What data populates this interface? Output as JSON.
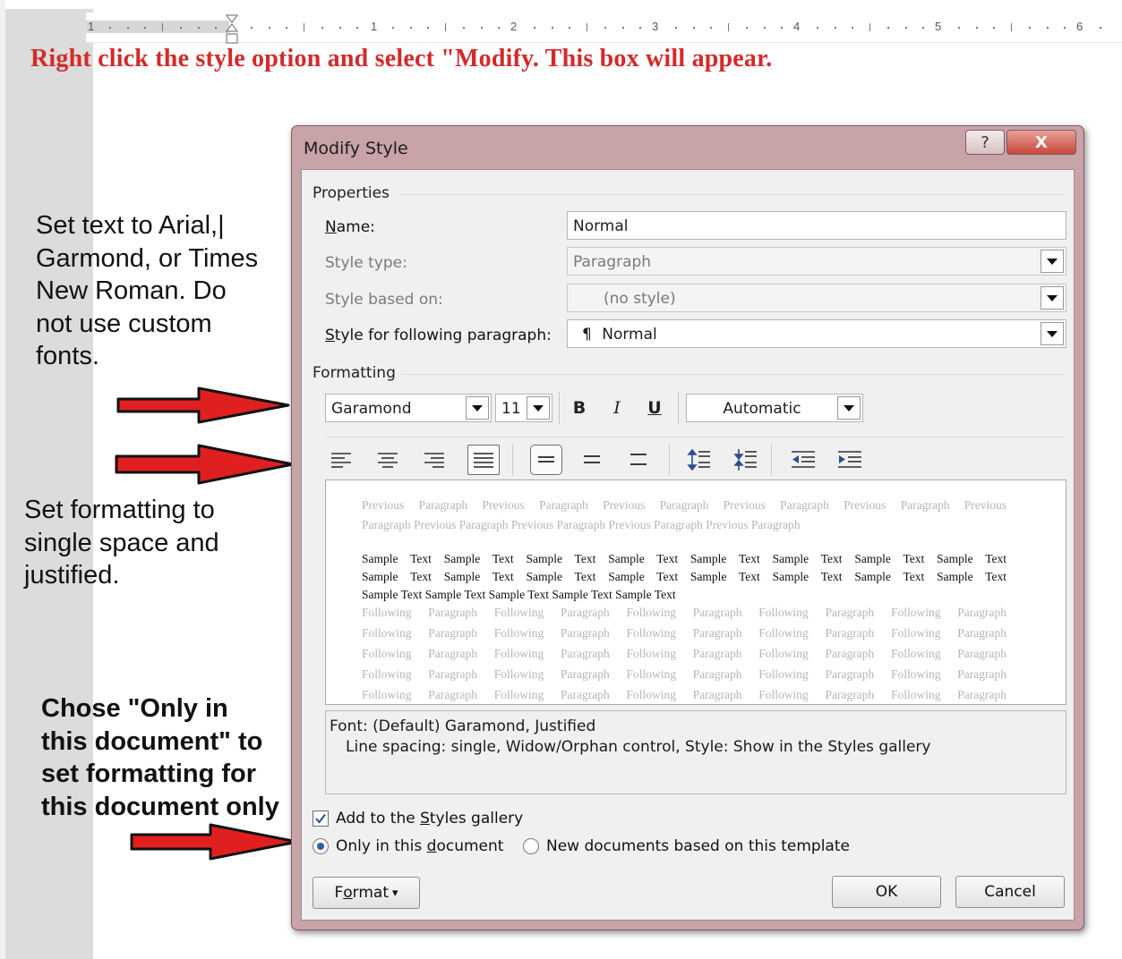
{
  "instruction_title": "Right click the style option and select \"Modify. This box will appear.",
  "notes": {
    "fonts_lines": [
      "Set text to Arial,|",
      "Garmond, or Times",
      "New Roman. Do",
      "not use custom",
      "fonts."
    ],
    "formatting_lines": [
      "Set formatting to",
      "single space and",
      "justified."
    ],
    "document_lines": [
      "Chose \"Only in",
      "this document\" to",
      "set formatting for",
      "this document only"
    ]
  },
  "ruler": {
    "numbers": [
      "1",
      "1",
      "2",
      "3",
      "4",
      "5",
      "6"
    ]
  },
  "dialog": {
    "title": "Modify Style",
    "help_glyph": "?",
    "close_glyph": "X",
    "properties": {
      "heading": "Properties",
      "name_label_key": "N",
      "name_label_rest": "ame:",
      "name_value": "Normal",
      "style_type_label": "Style type:",
      "style_type_value": "Paragraph",
      "based_on_label": "Style based on:",
      "based_on_value": "(no style)",
      "following_label_key": "S",
      "following_label_rest": "tyle for following paragraph:",
      "following_icon": "¶",
      "following_value": "Normal"
    },
    "formatting": {
      "heading": "Formatting",
      "font": "Garamond",
      "size": "11",
      "bold": "B",
      "italic": "I",
      "underline": "U",
      "color": "Automatic"
    },
    "preview": {
      "previous_lines": [
        "Previous Paragraph Previous Paragraph Previous Paragraph Previous Paragraph Previous Paragraph Previous",
        "Paragraph Previous Paragraph Previous Paragraph Previous Paragraph Previous Paragraph"
      ],
      "sample_lines": [
        "Sample Text Sample Text Sample Text Sample Text Sample Text Sample Text Sample Text Sample Text",
        "Sample Text Sample Text Sample Text Sample Text Sample Text Sample Text Sample Text Sample Text",
        "Sample Text Sample Text Sample Text Sample Text Sample Text"
      ],
      "following_lines": [
        "Following Paragraph Following Paragraph Following Paragraph Following Paragraph Following Paragraph",
        "Following Paragraph Following Paragraph Following Paragraph Following Paragraph Following Paragraph",
        "Following Paragraph Following Paragraph Following Paragraph Following Paragraph Following Paragraph",
        "Following Paragraph Following Paragraph Following Paragraph Following Paragraph Following Paragraph",
        "Following Paragraph Following Paragraph Following Paragraph Following Paragraph Following Paragraph"
      ]
    },
    "description": {
      "line1": "Font: (Default) Garamond, Justified",
      "line2": "Line spacing:  single, Widow/Orphan control, Style: Show in the Styles gallery"
    },
    "add_to_gallery": {
      "checked": true,
      "label_pre": "Add to the ",
      "label_key": "S",
      "label_post": "tyles gallery"
    },
    "scope": {
      "selected": "only_this_document",
      "only_label_pre": "Only in this ",
      "only_label_key": "d",
      "only_label_post": "ocument",
      "new_docs_label": "New documents based on this template"
    },
    "buttons": {
      "format_pre": "F",
      "format_key": "o",
      "format_post": "rmat",
      "format_arrow": "▾",
      "ok": "OK",
      "cancel": "Cancel"
    }
  },
  "colors": {
    "instruction_red": "#d42a2a",
    "arrow_red": "#e02020",
    "dialog_frame": "#c8a3a7",
    "close_button": "#c8473a",
    "radio_selected": "#2b5fa8"
  }
}
